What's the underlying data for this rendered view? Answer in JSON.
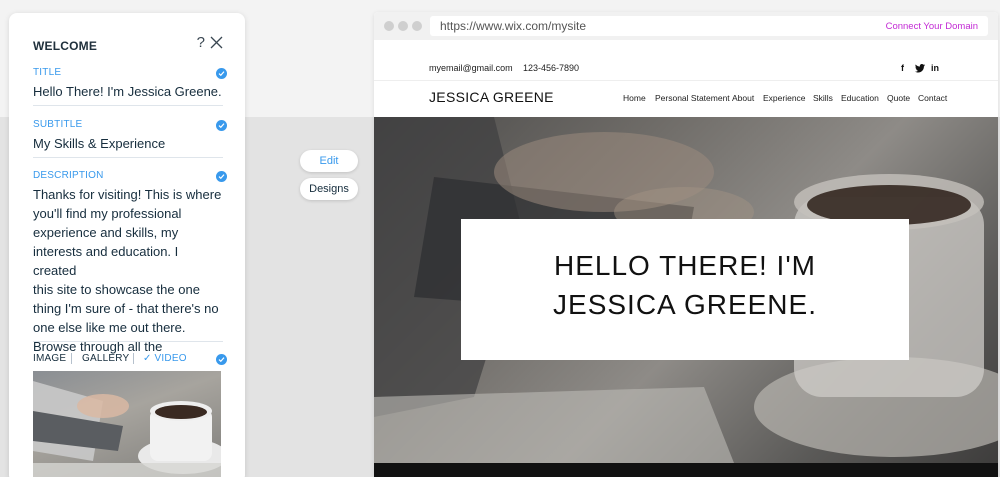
{
  "panel": {
    "title": "WELCOME",
    "help_glyph": "?",
    "fields": [
      {
        "label": "TITLE",
        "value": "Hello There! I'm Jessica Greene."
      },
      {
        "label": "SUBTITLE",
        "value": "My Skills & Experience"
      },
      {
        "label": "DESCRIPTION",
        "value_lines": [
          "Thanks for visiting! This is where",
          "you'll find my professional",
          "experience and skills, my",
          "interests and education. I created",
          "this site to showcase the one",
          "thing I'm sure of - that there's no",
          "one else like me out there.",
          "Browse through all the"
        ]
      }
    ],
    "media_tabs": {
      "image": "IMAGE",
      "gallery": "GALLERY",
      "video": "✓ VIDEO"
    }
  },
  "side_buttons": {
    "edit": "Edit",
    "designs": "Designs"
  },
  "browser": {
    "url": "https://www.wix.com/mysite",
    "connect_domain": "Connect Your Domain"
  },
  "site": {
    "email": "myemail@gmail.com",
    "phone": "123-456-7890",
    "social": {
      "facebook": "f",
      "twitter": "🐦",
      "linkedin": "in"
    },
    "name": "JESSICA GREENE",
    "nav": [
      "Home",
      "Personal Statement",
      "About",
      "Experience",
      "Skills",
      "Education",
      "Quote",
      "Contact"
    ],
    "hero_lines": [
      "HELLO THERE! I'M",
      "JESSICA GREENE."
    ]
  },
  "colors": {
    "accent": "#3899ec",
    "link": "#c32ad5"
  },
  "icons": [
    "help-icon",
    "close-icon",
    "check-icon",
    "facebook-icon",
    "twitter-icon",
    "linkedin-icon"
  ]
}
